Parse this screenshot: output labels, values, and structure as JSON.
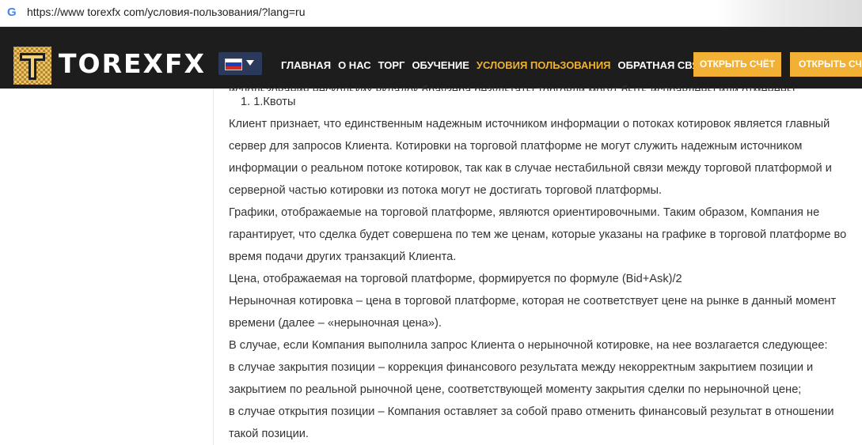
{
  "browser": {
    "url": "https://www torexfx com/условия-пользования/?lang=ru",
    "favicon": "google-g-icon"
  },
  "header": {
    "logo_text": "TOREXFX",
    "language": "ru",
    "nav": [
      {
        "label": "ГЛАВНАЯ",
        "active": false
      },
      {
        "label": "О НАС",
        "active": false
      },
      {
        "label": "ТОРГ",
        "active": false
      },
      {
        "label": "ОБУЧЕНИЕ",
        "active": false
      },
      {
        "label": "УСЛОВИЯ ПОЛЬЗОВАНИЯ",
        "active": true
      },
      {
        "label": "ОБРАТНАЯ СВЯЗЬ",
        "active": false
      }
    ],
    "cta_primary": "ОТКРЫТЬ СЧЁТ",
    "cta_secondary": "ОТКРЫТЬ СЧЁТ",
    "colors": {
      "bar": "#1d1d1d",
      "accent": "#f2b135",
      "active_nav": "#f0b232"
    }
  },
  "content": {
    "top_cut": "использования нескольких вкладок браузера результаты торговли могут быть исправлены или отменены.",
    "list_item": "1. 1.Квоты",
    "paragraphs": [
      "Клиент признает, что единственным надежным источником информации о потоках котировок является главный сервер для запросов Клиента. Котировки на торговой платформе не могут служить надежным источником информации о реальном потоке котировок, так как в случае нестабильной связи между торговой платформой и серверной частью котировки из потока могут не достигать торговой платформы.",
      "Графики, отображаемые на торговой платформе, являются ориентировочными. Таким образом, Компания не гарантирует, что сделка будет совершена по тем же ценам, которые указаны на графике в торговой платформе во время подачи других транзакций Клиента.",
      "Цена, отображаемая на торговой платформе, формируется по формуле (Bid+Ask)/2",
      "Нерыночная котировка – цена в торговой платформе, которая не соответствует цене на рынке в данный момент времени (далее – «нерыночная цена»).",
      "В случае, если Компания выполнила запрос Клиента о нерыночной котировке, на нее возлагается следующее:",
      "в случае закрытия позиции – коррекция финансового результата между некорректным закрытием позиции и закрытием по реальной рыночной цене, соответствующей моменту закрытия сделки по нерыночной цене;",
      "в случае открытия позиции – Компания оставляет за собой право отменить финансовый результат в отношении такой позиции."
    ]
  }
}
